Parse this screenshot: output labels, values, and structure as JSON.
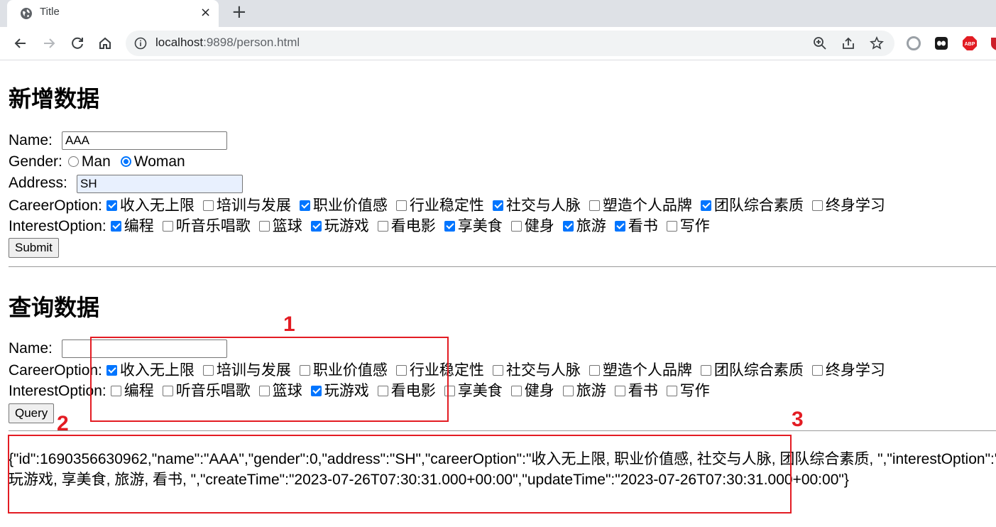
{
  "browser": {
    "tab_title": "Title",
    "tab_close": "×",
    "new_tab": "+",
    "url_host": "localhost",
    "url_rest": ":9898/person.html"
  },
  "add_section": {
    "heading": "新增数据",
    "name_label": "Name:",
    "name_value": "AAA",
    "gender_label": "Gender:",
    "gender_options": [
      {
        "label": "Man",
        "checked": false
      },
      {
        "label": "Woman",
        "checked": true
      }
    ],
    "address_label": "Address:",
    "address_value": "SH",
    "career_label": "CareerOption:",
    "career_options": [
      {
        "label": "收入无上限",
        "checked": true
      },
      {
        "label": "培训与发展",
        "checked": false
      },
      {
        "label": "职业价值感",
        "checked": true
      },
      {
        "label": "行业稳定性",
        "checked": false
      },
      {
        "label": "社交与人脉",
        "checked": true
      },
      {
        "label": "塑造个人品牌",
        "checked": false
      },
      {
        "label": "团队综合素质",
        "checked": true
      },
      {
        "label": "终身学习",
        "checked": false
      }
    ],
    "interest_label": "InterestOption:",
    "interest_options": [
      {
        "label": "编程",
        "checked": true
      },
      {
        "label": "听音乐唱歌",
        "checked": false
      },
      {
        "label": "篮球",
        "checked": false
      },
      {
        "label": "玩游戏",
        "checked": true
      },
      {
        "label": "看电影",
        "checked": false
      },
      {
        "label": "享美食",
        "checked": true
      },
      {
        "label": "健身",
        "checked": false
      },
      {
        "label": "旅游",
        "checked": true
      },
      {
        "label": "看书",
        "checked": true
      },
      {
        "label": "写作",
        "checked": false
      }
    ],
    "submit_label": "Submit"
  },
  "query_section": {
    "heading": "查询数据",
    "name_label": "Name:",
    "name_value": "",
    "career_label": "CareerOption:",
    "career_options": [
      {
        "label": "收入无上限",
        "checked": true
      },
      {
        "label": "培训与发展",
        "checked": false
      },
      {
        "label": "职业价值感",
        "checked": false
      },
      {
        "label": "行业稳定性",
        "checked": false
      },
      {
        "label": "社交与人脉",
        "checked": false
      },
      {
        "label": "塑造个人品牌",
        "checked": false
      },
      {
        "label": "团队综合素质",
        "checked": false
      },
      {
        "label": "终身学习",
        "checked": false
      }
    ],
    "interest_label": "InterestOption:",
    "interest_options": [
      {
        "label": "编程",
        "checked": false
      },
      {
        "label": "听音乐唱歌",
        "checked": false
      },
      {
        "label": "篮球",
        "checked": false
      },
      {
        "label": "玩游戏",
        "checked": true
      },
      {
        "label": "看电影",
        "checked": false
      },
      {
        "label": "享美食",
        "checked": false
      },
      {
        "label": "健身",
        "checked": false
      },
      {
        "label": "旅游",
        "checked": false
      },
      {
        "label": "看书",
        "checked": false
      },
      {
        "label": "写作",
        "checked": false
      }
    ],
    "query_label": "Query"
  },
  "result": {
    "line1": "{\"id\":1690356630962,\"name\":\"AAA\",\"gender\":0,\"address\":\"SH\",\"careerOption\":\"收入无上限, 职业价值感, 社交与人脉, 团队综合素质, \",\"interestOption\":\"编程,",
    "line2": "玩游戏, 享美食, 旅游, 看书, \",\"createTime\":\"2023-07-26T07:30:31.000+00:00\",\"updateTime\":\"2023-07-26T07:30:31.000+00:00\"}"
  },
  "annotations": {
    "mark1": "1",
    "mark2": "2",
    "mark3": "3",
    "color": "#e31c23"
  },
  "colors": {
    "checkbox_accent": "#0075ff",
    "autofill_bg": "#e8f0fe"
  }
}
